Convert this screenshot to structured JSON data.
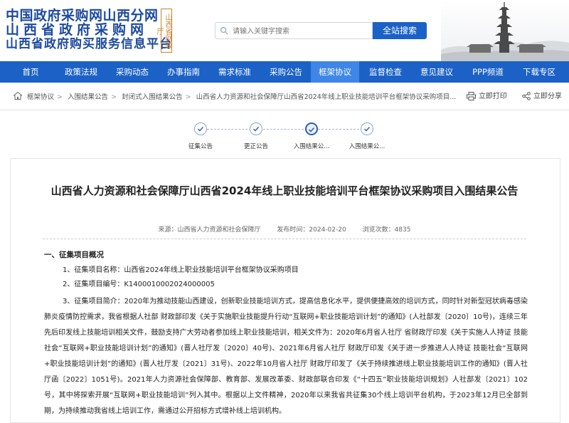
{
  "header": {
    "site_title_1": "中国政府采购网山西分网",
    "site_title_2": "山西省政府采购网",
    "site_title_3": "山西省政府购买服务信息平台",
    "badge": "山西省财政厅",
    "search_placeholder": "请输入关键字搜索",
    "search_button": "全站搜索"
  },
  "nav": {
    "items": [
      "首页",
      "政策法规",
      "采购动态",
      "办事指南",
      "需求标准",
      "采购公告",
      "框架协议",
      "监督检查",
      "意见建议",
      "PPP频道",
      "下载专区"
    ],
    "active_index": 6
  },
  "breadcrumb": {
    "items": [
      "框架协议",
      "入围结果公告",
      "封闭式入围结果公告",
      "山西省人力资源和社会保障厅山西省2024年线上职业技能培训平台框架协议采购项目..."
    ]
  },
  "tools": {
    "print": "立即打印",
    "share": "立即分享"
  },
  "steps": {
    "items": [
      "征集公告",
      "更正公告",
      "入围结果公...",
      "入围结果公..."
    ],
    "active_index": 2
  },
  "article": {
    "title": "山西省人力资源和社会保障厅山西省2024年线上职业技能培训平台框架协议采购项目入围结果公告",
    "source": "来源：山西省人力资源和社会保障厅",
    "date": "发布时间：2024-02-20",
    "views": "浏览次数：4835",
    "section1": "一、征集项目概况",
    "item1": "1、征集项目名称：山西省2024年线上职业技能培训平台框架协议采购项目",
    "item2": "2、征集项目编号：K1400010002024000005",
    "item3": "3、征集项目简介：2020年为推动技能山西建设，创新职业技能培训方式，提高信息化水平，提供便捷高效的培训方式，同时针对新型冠状病毒感染肺炎疫情防控需求，我省根据人社部 财政部印发《关于实施职业技能提升行动“互联网+职业技能培训计划”的通知》(人社部发〔2020〕10号)，连续三年先后印发线上技能培训相关文件，鼓励支持广大劳动者参加线上职业技能培训，相关文件为：2020年6月省人社厅 省财政厅印发《关于实施人人持证 技能社会“互联网+职业技能培训计划”的通知》(晋人社厅发〔2020〕40号)、2021年6月省人社厅 财政厅印发《关于进一步推进人人持证 技能社会“互联网+职业技能培训计划”的通知》(晋人社厅发〔2021〕31号)、2022年10月省人社厅 财政厅印发了《关于持续推进线上职业技能培训工作的通知》(晋人社厅函〔2022〕1051号)。2021年人力资源社会保障部、教育部、发展改革委、财政部联合印发《“十四五”职业技能培训规划》人社部发〔2021〕102号，其中将探索开展“互联网+职业技能培训”列入其中。根据以上文件精神，2020年以来我省共征集30个线上培训平台机构，于2023年12月已全部到期，为持续推动我省线上培训工作，需通过公开招标方式增补线上培训机构。"
  }
}
